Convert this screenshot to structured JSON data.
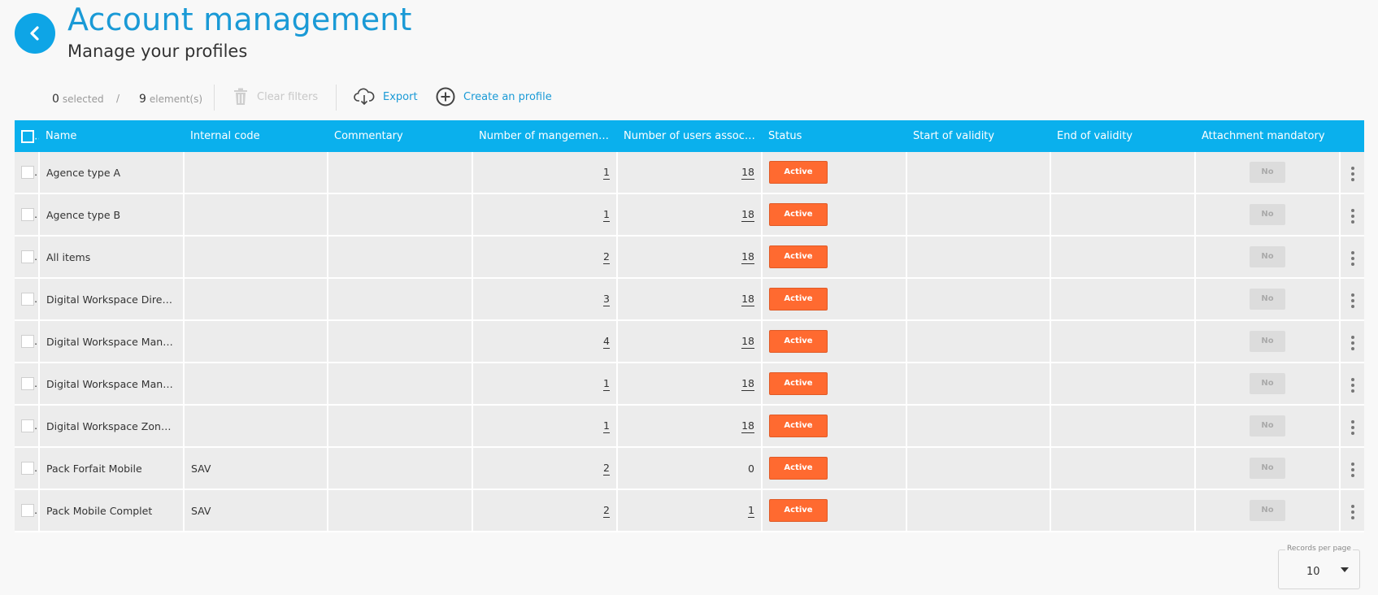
{
  "header": {
    "title": "Account management",
    "subtitle": "Manage your profiles"
  },
  "toolbar": {
    "selected_count": "0",
    "selected_label": "selected",
    "separator": "/",
    "element_count": "9",
    "element_label": "element(s)",
    "clear_filters_label": "Clear filters",
    "export_label": "Export",
    "create_label": "Create an profile"
  },
  "table": {
    "columns": [
      "Name",
      "Internal code",
      "Commentary",
      "Number of mangement ...",
      "Number of users associa...",
      "Status",
      "Start of validity",
      "End of validity",
      "Attachment mandatory"
    ],
    "rows": [
      {
        "name": "Agence type A",
        "internal_code": "",
        "commentary": "",
        "mgmt_count": "1",
        "users_count": "18",
        "status": "Active",
        "start": "",
        "end": "",
        "attachment": "No"
      },
      {
        "name": "Agence type B",
        "internal_code": "",
        "commentary": "",
        "mgmt_count": "1",
        "users_count": "18",
        "status": "Active",
        "start": "",
        "end": "",
        "attachment": "No"
      },
      {
        "name": "All items",
        "internal_code": "",
        "commentary": "",
        "mgmt_count": "2",
        "users_count": "18",
        "status": "Active",
        "start": "",
        "end": "",
        "attachment": "No"
      },
      {
        "name": "Digital Workspace Director",
        "internal_code": "",
        "commentary": "",
        "mgmt_count": "3",
        "users_count": "18",
        "status": "Active",
        "start": "",
        "end": "",
        "attachment": "No"
      },
      {
        "name": "Digital Workspace Manager",
        "internal_code": "",
        "commentary": "",
        "mgmt_count": "4",
        "users_count": "18",
        "status": "Active",
        "start": "",
        "end": "",
        "attachment": "No"
      },
      {
        "name": "Digital Workspace Manag...",
        "internal_code": "",
        "commentary": "",
        "mgmt_count": "1",
        "users_count": "18",
        "status": "Active",
        "start": "",
        "end": "",
        "attachment": "No"
      },
      {
        "name": "Digital Workspace Zone A...",
        "internal_code": "",
        "commentary": "",
        "mgmt_count": "1",
        "users_count": "18",
        "status": "Active",
        "start": "",
        "end": "",
        "attachment": "No"
      },
      {
        "name": "Pack Forfait Mobile",
        "internal_code": "SAV",
        "commentary": "",
        "mgmt_count": "2",
        "users_count": "0",
        "status": "Active",
        "start": "",
        "end": "",
        "attachment": "No"
      },
      {
        "name": "Pack Mobile Complet",
        "internal_code": "SAV",
        "commentary": "",
        "mgmt_count": "2",
        "users_count": "1",
        "status": "Active",
        "start": "",
        "end": "",
        "attachment": "No"
      }
    ]
  },
  "pagination": {
    "records_label": "Records per page",
    "records_value": "10"
  },
  "icons": {
    "back": "chevron-left-icon",
    "clear_filters": "trash-icon",
    "export": "cloud-download-icon",
    "create": "plus-circle-icon",
    "row_menu": "more-vertical-icon"
  },
  "colors": {
    "accent": "#1a9ad6",
    "header_bg": "#0ab0ed",
    "status_active": "#ff6a30"
  }
}
